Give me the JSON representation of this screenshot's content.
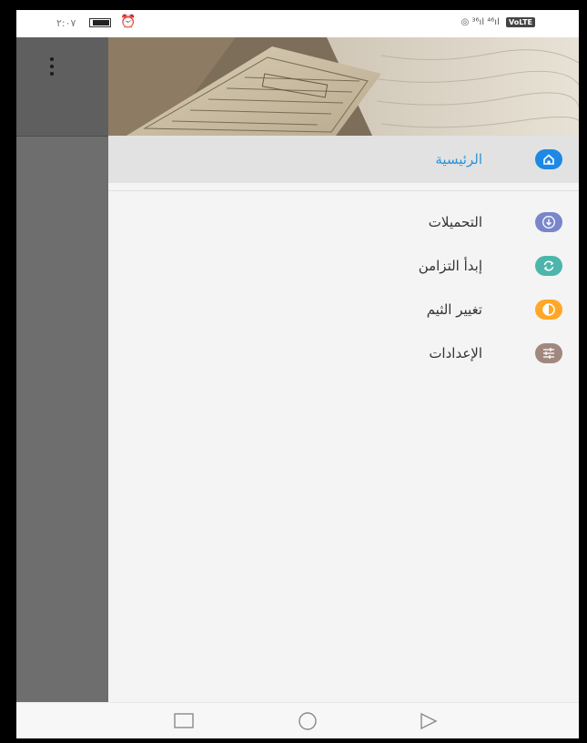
{
  "status_bar": {
    "time": "٢:٠٧",
    "right_text": "◎ ³⁶ıl ⁴⁶ıl",
    "volte": "VoLTE",
    "battery_icon": "battery-icon",
    "alarm_icon": "alarm-clock-icon"
  },
  "drawer": {
    "header_image": "quran-book-photo",
    "menu": [
      {
        "label": "الرئيسية",
        "icon": "home-icon",
        "color": "#1e88e5",
        "active": true
      },
      {
        "label": "التحميلات",
        "icon": "download-icon",
        "color": "#7986cb",
        "active": false
      },
      {
        "label": "إبدأ التزامن",
        "icon": "sync-icon",
        "color": "#4db6ac",
        "active": false
      },
      {
        "label": "تغيير الثيم",
        "icon": "theme-contrast-icon",
        "color": "#ffa726",
        "active": false
      },
      {
        "label": "الإعدادات",
        "icon": "settings-sliders-icon",
        "color": "#a1887f",
        "active": false
      }
    ]
  },
  "colors": {
    "active_text": "#2d93d6",
    "scrim": "#6e6e6e",
    "drawer_bg": "#f4f4f4"
  },
  "nav_bar": {
    "buttons": [
      "recent-apps-icon",
      "home-circle-icon",
      "back-triangle-icon"
    ]
  }
}
